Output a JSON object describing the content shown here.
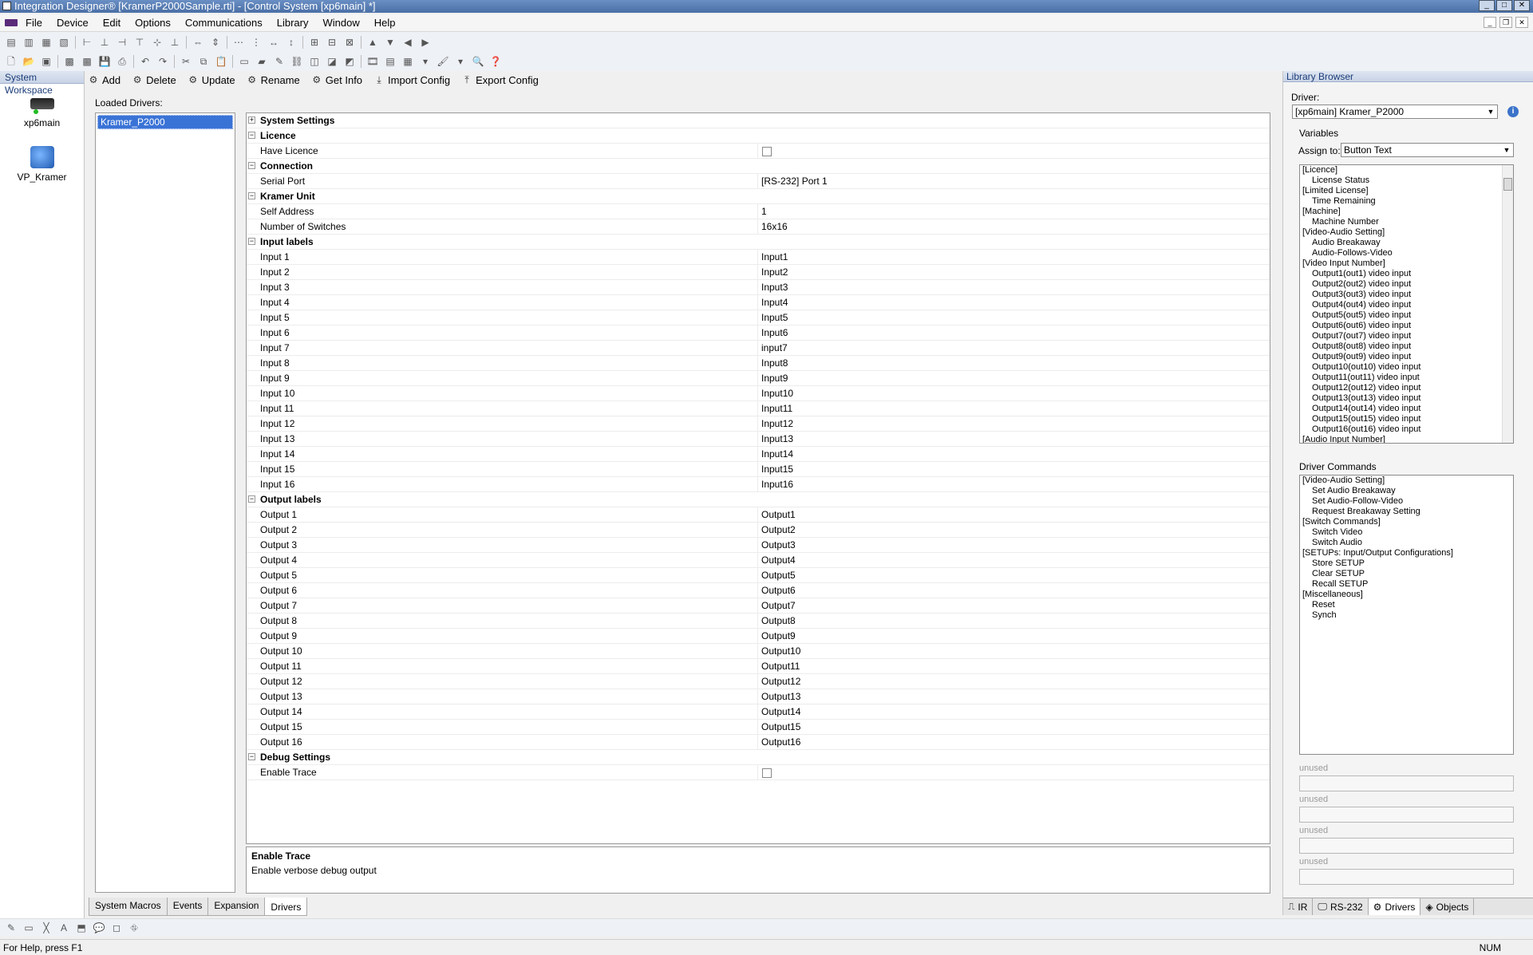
{
  "window": {
    "title": "Integration Designer® [KramerP2000Sample.rti] - [Control System [xp6main] *]"
  },
  "menu": [
    "File",
    "Device",
    "Edit",
    "Options",
    "Communications",
    "Library",
    "Window",
    "Help"
  ],
  "workspace": {
    "title": "System Workspace",
    "items": [
      {
        "label": "xp6main"
      },
      {
        "label": "VP_Kramer"
      }
    ]
  },
  "actions": [
    {
      "label": "Add"
    },
    {
      "label": "Delete"
    },
    {
      "label": "Update"
    },
    {
      "label": "Rename"
    },
    {
      "label": "Get Info"
    },
    {
      "label": "Import Config"
    },
    {
      "label": "Export Config"
    }
  ],
  "loaded_drivers": {
    "label": "Loaded Drivers:",
    "items": [
      "Kramer_P2000"
    ]
  },
  "properties": {
    "system_settings": "System Settings",
    "licence": {
      "title": "Licence",
      "rows": [
        {
          "name": "Have Licence"
        }
      ]
    },
    "connection": {
      "title": "Connection",
      "rows": [
        {
          "name": "Serial Port",
          "value": "[RS-232] Port 1"
        }
      ]
    },
    "kramer_unit": {
      "title": "Kramer Unit",
      "rows": [
        {
          "name": "Self Address",
          "value": "1"
        },
        {
          "name": "Number of Switches",
          "value": "16x16"
        }
      ]
    },
    "input_labels": {
      "title": "Input labels",
      "rows": [
        {
          "name": "Input 1",
          "value": "Input1"
        },
        {
          "name": "Input 2",
          "value": "Input2"
        },
        {
          "name": "Input 3",
          "value": "Input3"
        },
        {
          "name": "Input 4",
          "value": "Input4"
        },
        {
          "name": "Input 5",
          "value": "Input5"
        },
        {
          "name": "Input 6",
          "value": "Input6"
        },
        {
          "name": "Input 7",
          "value": "input7"
        },
        {
          "name": "Input 8",
          "value": "Input8"
        },
        {
          "name": "Input 9",
          "value": "Input9"
        },
        {
          "name": "Input 10",
          "value": "Input10"
        },
        {
          "name": "Input 11",
          "value": "Input11"
        },
        {
          "name": "Input 12",
          "value": "Input12"
        },
        {
          "name": "Input 13",
          "value": "Input13"
        },
        {
          "name": "Input 14",
          "value": "Input14"
        },
        {
          "name": "Input 15",
          "value": "Input15"
        },
        {
          "name": "Input 16",
          "value": "Input16"
        }
      ]
    },
    "output_labels": {
      "title": "Output labels",
      "rows": [
        {
          "name": "Output 1",
          "value": "Output1"
        },
        {
          "name": "Output 2",
          "value": "Output2"
        },
        {
          "name": "Output 3",
          "value": "Output3"
        },
        {
          "name": "Output 4",
          "value": "Output4"
        },
        {
          "name": "Output 5",
          "value": "Output5"
        },
        {
          "name": "Output 6",
          "value": "Output6"
        },
        {
          "name": "Output 7",
          "value": "Output7"
        },
        {
          "name": "Output 8",
          "value": "Output8"
        },
        {
          "name": "Output 9",
          "value": "Output9"
        },
        {
          "name": "Output 10",
          "value": "Output10"
        },
        {
          "name": "Output 11",
          "value": "Output11"
        },
        {
          "name": "Output 12",
          "value": "Output12"
        },
        {
          "name": "Output 13",
          "value": "Output13"
        },
        {
          "name": "Output 14",
          "value": "Output14"
        },
        {
          "name": "Output 15",
          "value": "Output15"
        },
        {
          "name": "Output 16",
          "value": "Output16"
        }
      ]
    },
    "debug": {
      "title": "Debug Settings",
      "rows": [
        {
          "name": "Enable Trace"
        }
      ]
    }
  },
  "description": {
    "title": "Enable Trace",
    "text": "Enable verbose debug output"
  },
  "bottom_tabs": [
    "System Macros",
    "Events",
    "Expansion",
    "Drivers"
  ],
  "status": {
    "help": "For Help, press F1",
    "num": "NUM"
  },
  "library": {
    "title": "Library Browser",
    "driver_label": "Driver:",
    "driver_value": "[xp6main] Kramer_P2000",
    "variables_label": "Variables",
    "assign_label": "Assign to:",
    "assign_value": "Button Text",
    "variables": [
      {
        "text": "[Licence]",
        "indent": false
      },
      {
        "text": "License Status",
        "indent": true
      },
      {
        "text": "[Limited License]",
        "indent": false
      },
      {
        "text": "Time Remaining",
        "indent": true
      },
      {
        "text": "[Machine]",
        "indent": false
      },
      {
        "text": "Machine Number",
        "indent": true
      },
      {
        "text": "[Video-Audio Setting]",
        "indent": false
      },
      {
        "text": "Audio Breakaway",
        "indent": true
      },
      {
        "text": "Audio-Follows-Video",
        "indent": true
      },
      {
        "text": "[Video Input Number]",
        "indent": false
      },
      {
        "text": "Output1(out1) video input",
        "indent": true
      },
      {
        "text": "Output2(out2) video input",
        "indent": true
      },
      {
        "text": "Output3(out3) video input",
        "indent": true
      },
      {
        "text": "Output4(out4) video input",
        "indent": true
      },
      {
        "text": "Output5(out5) video input",
        "indent": true
      },
      {
        "text": "Output6(out6) video input",
        "indent": true
      },
      {
        "text": "Output7(out7) video input",
        "indent": true
      },
      {
        "text": "Output8(out8) video input",
        "indent": true
      },
      {
        "text": "Output9(out9) video input",
        "indent": true
      },
      {
        "text": "Output10(out10) video input",
        "indent": true
      },
      {
        "text": "Output11(out11) video input",
        "indent": true
      },
      {
        "text": "Output12(out12) video input",
        "indent": true
      },
      {
        "text": "Output13(out13) video input",
        "indent": true
      },
      {
        "text": "Output14(out14) video input",
        "indent": true
      },
      {
        "text": "Output15(out15) video input",
        "indent": true
      },
      {
        "text": "Output16(out16) video input",
        "indent": true
      },
      {
        "text": "[Audio Input Number]",
        "indent": false
      }
    ],
    "commands_label": "Driver Commands",
    "commands": [
      {
        "text": "[Video-Audio Setting]",
        "indent": false
      },
      {
        "text": "Set Audio Breakaway",
        "indent": true
      },
      {
        "text": "Set Audio-Follow-Video",
        "indent": true
      },
      {
        "text": "Request Breakaway Setting",
        "indent": true
      },
      {
        "text": "[Switch Commands]",
        "indent": false
      },
      {
        "text": "Switch Video",
        "indent": true
      },
      {
        "text": "Switch Audio",
        "indent": true
      },
      {
        "text": "[SETUPs: Input/Output Configurations]",
        "indent": false
      },
      {
        "text": "Store SETUP",
        "indent": true
      },
      {
        "text": "Clear SETUP",
        "indent": true
      },
      {
        "text": "Recall SETUP",
        "indent": true
      },
      {
        "text": "[Miscellaneous]",
        "indent": false
      },
      {
        "text": "Reset",
        "indent": true
      },
      {
        "text": "Synch",
        "indent": true
      }
    ],
    "unused": [
      "unused",
      "unused",
      "unused",
      "unused"
    ],
    "tabs": [
      "IR",
      "RS-232",
      "Drivers",
      "Objects"
    ]
  }
}
